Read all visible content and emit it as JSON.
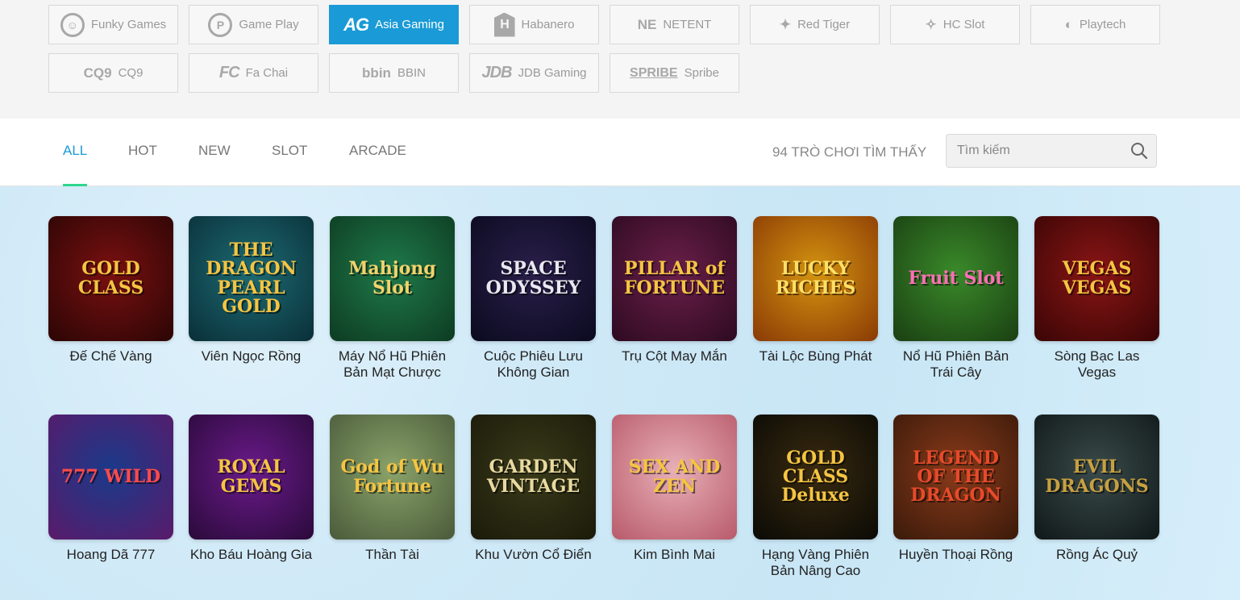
{
  "providers": [
    {
      "label": "Funky Games",
      "logo_text": "☺",
      "logo_style": "circle",
      "active": false
    },
    {
      "label": "Game Play",
      "logo_text": "P",
      "logo_style": "circle",
      "active": false
    },
    {
      "label": "Asia Gaming",
      "logo_text": "AG",
      "logo_style": "",
      "active": true
    },
    {
      "label": "Habanero",
      "logo_text": "H",
      "logo_style": "box",
      "active": false
    },
    {
      "label": "NETENT",
      "logo_text": "NE",
      "logo_style": "sm",
      "active": false
    },
    {
      "label": "Red Tiger",
      "logo_text": "✦",
      "logo_style": "sm",
      "active": false
    },
    {
      "label": "HC Slot",
      "logo_text": "✧",
      "logo_style": "sm",
      "active": false
    },
    {
      "label": "Playtech",
      "logo_text": "◐",
      "logo_style": "sm",
      "active": false
    },
    {
      "label": "CQ9",
      "logo_text": "CQ9",
      "logo_style": "sm",
      "active": false
    },
    {
      "label": "Fa Chai",
      "logo_text": "FC",
      "logo_style": "",
      "active": false
    },
    {
      "label": "BBIN",
      "logo_text": "bbin",
      "logo_style": "sm",
      "active": false
    },
    {
      "label": "JDB Gaming",
      "logo_text": "JDB",
      "logo_style": "",
      "active": false
    },
    {
      "label": "Spribe",
      "logo_text": "SPRIBE",
      "logo_style": "ul",
      "active": false
    }
  ],
  "tabs": [
    "ALL",
    "HOT",
    "NEW",
    "SLOT",
    "ARCADE"
  ],
  "active_tab": "ALL",
  "result_count": "94 TRÒ CHƠI TÌM THẤY",
  "search": {
    "placeholder": "Tìm kiếm"
  },
  "colors": {
    "accent": "#1a9ad6",
    "tab_underline": "#2fd68e"
  },
  "games": [
    {
      "name": "Đế Chế Vàng",
      "thumb_text": "GOLD CLASS",
      "bg": "#7a1010",
      "bg2": "#2b0505",
      "fg": "#f5c542"
    },
    {
      "name": "Viên Ngọc Rồng",
      "thumb_text": "THE DRAGON PEARL GOLD",
      "bg": "#1d6b73",
      "bg2": "#0a2f38",
      "fg": "#f4c542"
    },
    {
      "name": "Máy Nổ Hũ Phiên Bản Mạt Chược",
      "thumb_text": "Mahjong Slot",
      "bg": "#1f7a4a",
      "bg2": "#0d3b22",
      "fg": "#f2d36b"
    },
    {
      "name": "Cuộc Phiêu Lưu Không Gian",
      "thumb_text": "SPACE ODYSSEY",
      "bg": "#2a1f4a",
      "bg2": "#0b0a1f",
      "fg": "#e8e8f0"
    },
    {
      "name": "Trụ Cột May Mắn",
      "thumb_text": "PILLAR of FORTUNE",
      "bg": "#6b1f4a",
      "bg2": "#2d0a20",
      "fg": "#f5c542"
    },
    {
      "name": "Tài Lộc Bùng Phát",
      "thumb_text": "LUCKY RICHES",
      "bg": "#d49410",
      "bg2": "#8a3a05",
      "fg": "#ffe066"
    },
    {
      "name": "Nổ Hũ Phiên Bản Trái Cây",
      "thumb_text": "Fruit Slot",
      "bg": "#3a8a2a",
      "bg2": "#1a3f12",
      "fg": "#ff6fb5"
    },
    {
      "name": "Sòng Bạc Las Vegas",
      "thumb_text": "VEGAS VEGAS",
      "bg": "#8a1515",
      "bg2": "#3a0505",
      "fg": "#f5c542"
    },
    {
      "name": "Hoang Dã 777",
      "thumb_text": "777 WILD",
      "bg": "#1a3a8a",
      "bg2": "#5a1a6a",
      "fg": "#ff4a4a"
    },
    {
      "name": "Kho Báu Hoàng Gia",
      "thumb_text": "ROYAL GEMS",
      "bg": "#6a1a8a",
      "bg2": "#2a0a3a",
      "fg": "#f5c542"
    },
    {
      "name": "Thần Tài",
      "thumb_text": "God of Wu Fortune",
      "bg": "#8aa36a",
      "bg2": "#4a5a3a",
      "fg": "#f5c542"
    },
    {
      "name": "Khu Vườn Cổ Điển",
      "thumb_text": "GARDEN VINTAGE",
      "bg": "#3a3a1a",
      "bg2": "#1a1a0a",
      "fg": "#e8d9a0"
    },
    {
      "name": "Kim Bình Mai",
      "thumb_text": "SEX AND ZEN",
      "bg": "#e8b0b8",
      "bg2": "#b85a6a",
      "fg": "#f5c542"
    },
    {
      "name": "Hạng Vàng Phiên Bản Nâng Cao",
      "thumb_text": "GOLD CLASS Deluxe",
      "bg": "#3a2a10",
      "bg2": "#0a0a05",
      "fg": "#f5c542"
    },
    {
      "name": "Huyền Thoại Rồng",
      "thumb_text": "LEGEND OF THE DRAGON",
      "bg": "#8a3a1a",
      "bg2": "#3a1a0a",
      "fg": "#e84a2a"
    },
    {
      "name": "Rồng Ác Quỷ",
      "thumb_text": "EVIL DRAGONS",
      "bg": "#3a4a4a",
      "bg2": "#101818",
      "fg": "#c8a040"
    }
  ]
}
